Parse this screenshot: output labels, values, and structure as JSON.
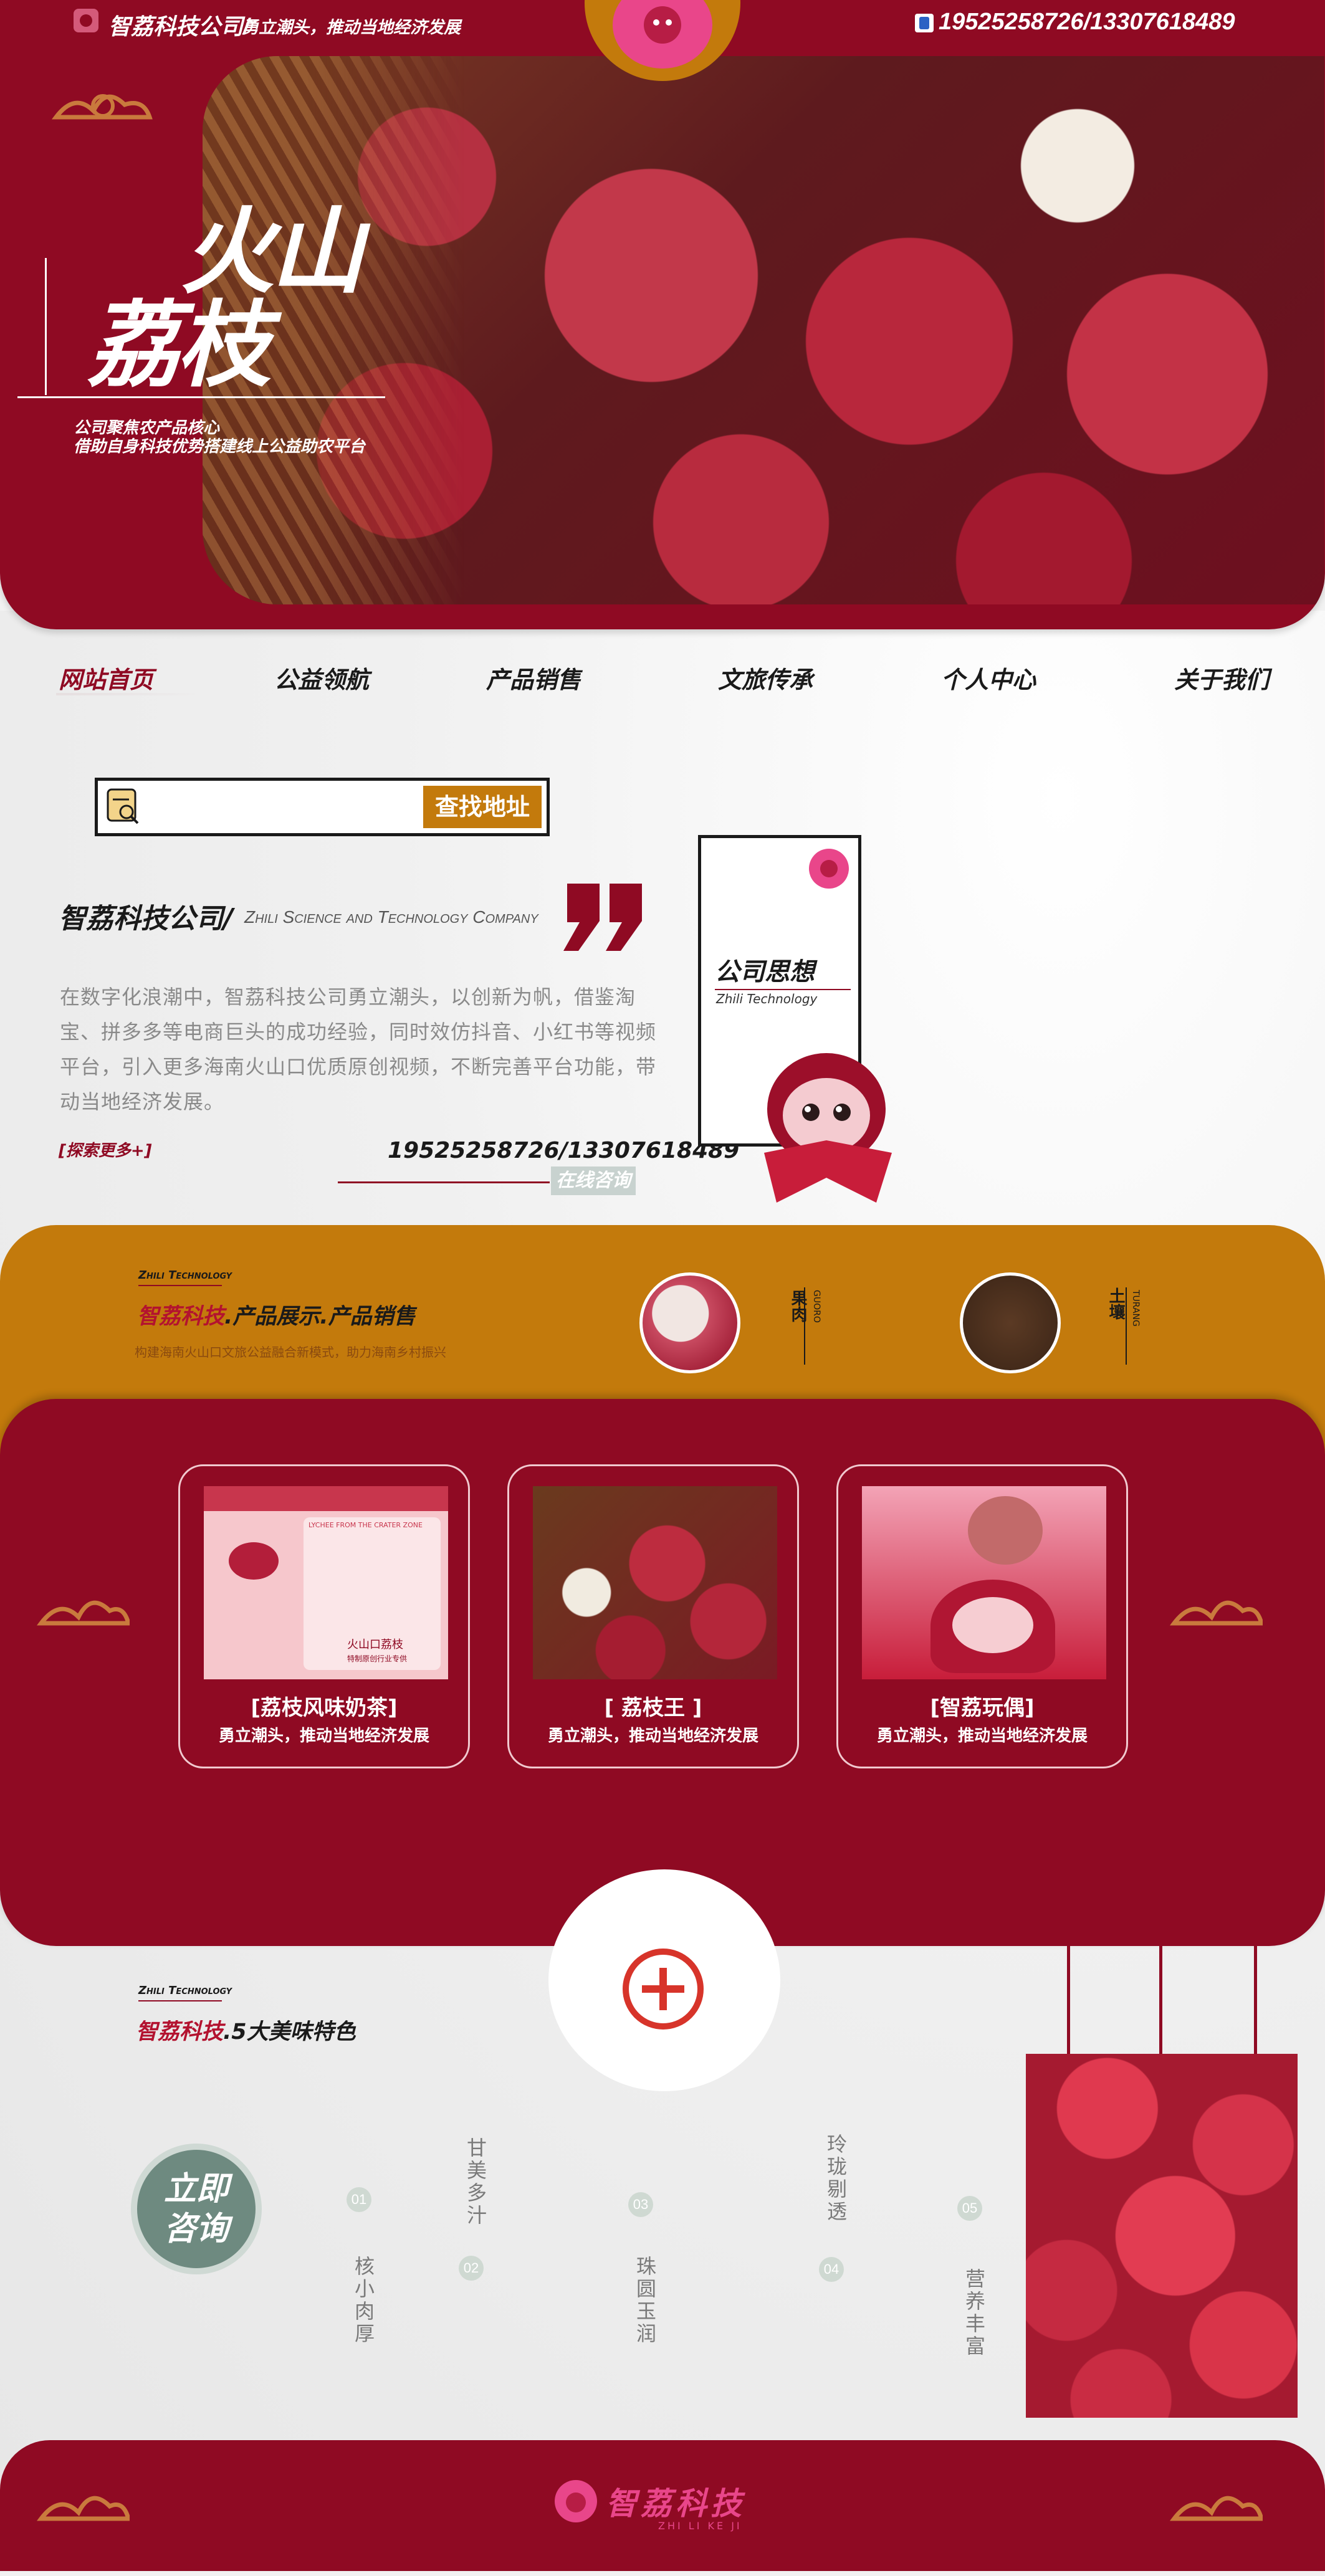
{
  "colors": {
    "maroon": "#8f0a23",
    "gold": "#c37a0c",
    "pink": "#e9468a",
    "text": "#1a1a1a",
    "muted": "#8a8a8a"
  },
  "header": {
    "company_name": "智荔科技公司/",
    "slogan": "勇立潮头，推动当地经济发展",
    "phone": "19525258726/13307618489",
    "big_title_line1": "火山",
    "big_title_line2": "荔枝",
    "subtitle_line1": "公司聚焦农产品核心",
    "subtitle_line2": "借助自身科技优势搭建线上公益助农平台"
  },
  "nav": {
    "items": [
      "网站首页",
      "公益领航",
      "产品销售",
      "文旅传承",
      "个人中心",
      "关于我们"
    ],
    "active": 0
  },
  "search": {
    "button_label": "查找地址",
    "placeholder": ""
  },
  "about": {
    "title_cn": "智荔科技公司/",
    "title_en": "Zhili Science and Technology Company",
    "body": "在数字化浪潮中，智荔科技公司勇立潮头，以创新为帆，借鉴淘宝、拼多多等电商巨头的成功经验，同时效仿抖音、小红书等视频平台，引入更多海南火山口优质原创视频，不断完善平台功能，带动当地经济发展。",
    "more_link": "[探索更多+]",
    "phone": "19525258726/13307618489",
    "consult_button": "在线咨询"
  },
  "thought_card": {
    "title": "公司思想",
    "subtitle": "Zhili Technology"
  },
  "products_band": {
    "brand_en": "Zhili Technology",
    "title_brand": "智荔科技",
    "title_rest": ".产品展示.产品销售",
    "desc": "构建海南火山口文旅公益融合新模式，助力海南乡村振兴",
    "items": [
      {
        "cn": "果肉",
        "en": "GUORO"
      },
      {
        "cn": "土壤",
        "en": "TURANG"
      }
    ]
  },
  "cards": [
    {
      "title": "[荔枝风味奶茶]",
      "sub": "勇立潮头，推动当地经济发展",
      "img_text": "火山口荔枝",
      "img_text2": "特制原创行业专供",
      "img_arc": "LYCHEE FROM THE CRATER ZONE"
    },
    {
      "title": "[ 荔枝王 ]",
      "sub": "勇立潮头，推动当地经济发展"
    },
    {
      "title": "[智荔玩偶]",
      "sub": "勇立潮头，推动当地经济发展"
    }
  ],
  "features": {
    "brand_en": "Zhili Technology",
    "title_brand": "智荔科技",
    "title_rest": ".5大美味特色",
    "consult_button": "立即咨询",
    "items": [
      {
        "num": "01",
        "text": "核小肉厚"
      },
      {
        "num": "02",
        "text": "甘美多汁"
      },
      {
        "num": "03",
        "text": "珠圆玉润"
      },
      {
        "num": "04",
        "text": "玲珑剔透"
      },
      {
        "num": "05",
        "text": "营养丰富"
      }
    ]
  },
  "footer": {
    "brand": "智荔科技",
    "brand_en": "ZHI LI KE JI"
  }
}
